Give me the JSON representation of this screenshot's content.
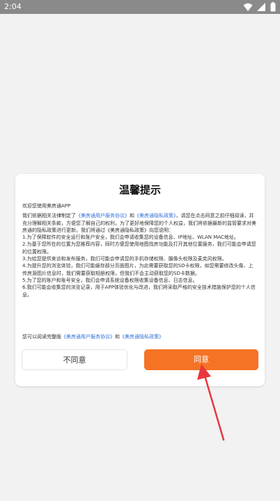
{
  "status_bar": {
    "time": "2:04"
  },
  "dialog": {
    "title": "温馨提示",
    "greeting": "欢迎您使用美房通APP",
    "intro_before": "我们依据相关法律制定了",
    "intro_link1": "《美房通用户服务协议》",
    "intro_mid": "和",
    "intro_link2": "《美房通隐私政策》",
    "intro_after": "，请您在点击同意之前仔细阅读，并充分理解相关条款，方便您了解自己的权利，为了更好地保障您的个人权益，我们将依据最新的监管要求对美房通的隐私政策进行更新。我们将通过《美房通隐私政策》向您说明：",
    "items": [
      "1.为了保障软件的安全运行和账户安全，我们会申请收集您的设备信息、IP地址、WLAN MAC地址。",
      "2.为基于您所在的位置为您推荐内容，同时方便您使用地图找房功能及打开其他位置服务，我们可能会申请您的位置权限。",
      "3.为给您提供来访和发布服务，我们可能会申请您的手机存储权限、摄像头权限及麦克风权限。",
      "4.为提升您的浏览体验，我们可能缓存部分页面图片，为此需要获取您的SD卡权限，如您需要修改头像、上传房源图片信息时，我们需要获取相册权限，但我们不会主动获取您的SD卡数据。",
      "5.为了您的账户和账号安全，我们会申请系统设备权限收集设备信息、日志信息。",
      "6.我们可能会收集您的浏览记录，用于APP体验优化与改进，我们将采取严格的安全技术措施保护您的个人信息。"
    ],
    "footer_before": "您可以阅读完整版",
    "footer_link1": "《美房通用户服务协议》",
    "footer_mid": "和",
    "footer_link2": "《美房通隐私政策》",
    "decline_label": "不同意",
    "agree_label": "同意"
  },
  "colors": {
    "accent": "#f57325",
    "link": "#2f6fd6",
    "annotation_arrow": "#e8383d"
  },
  "icons": [
    "wifi-icon",
    "signal-icon",
    "battery-icon"
  ]
}
